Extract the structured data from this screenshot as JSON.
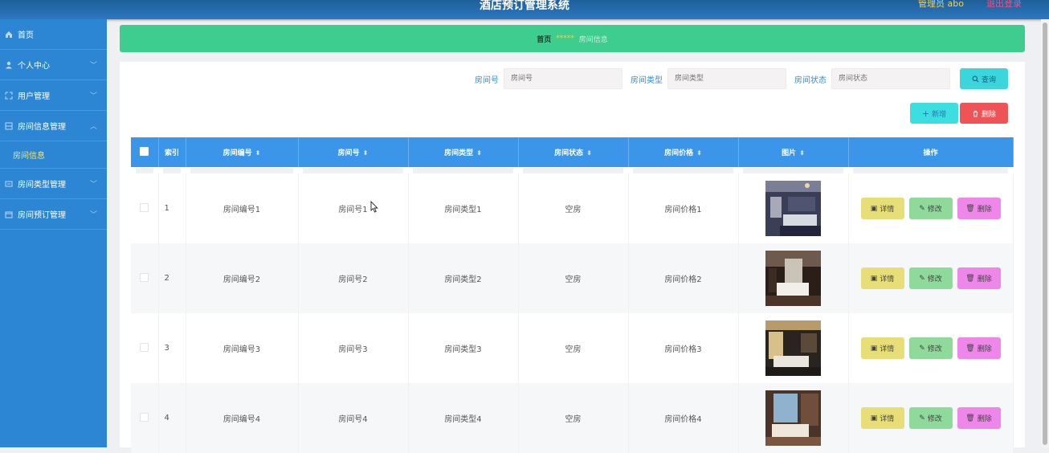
{
  "header": {
    "title": "酒店预订管理系统",
    "user": "管理员 abo",
    "logout": "退出登录"
  },
  "sidebar": {
    "items": [
      {
        "label": "首页",
        "icon": "home-icon"
      },
      {
        "label": "个人中心",
        "icon": "user-icon"
      },
      {
        "label": "用户管理",
        "icon": "users-icon"
      },
      {
        "label": "房间信息管理",
        "icon": "grid-icon"
      },
      {
        "label": "房间类型管理",
        "icon": "list-icon"
      },
      {
        "label": "房间预订管理",
        "icon": "calendar-icon"
      }
    ],
    "active_sub": "房间信息"
  },
  "breadcrumb": {
    "home": "首页",
    "stars": "*****",
    "current": "房间信息"
  },
  "search": {
    "room_no_label": "房间号",
    "room_no_placeholder": "房间号",
    "room_type_label": "房间类型",
    "room_type_placeholder": "房间类型",
    "room_status_label": "房间状态",
    "room_status_placeholder": "房间状态",
    "query_button": "查询"
  },
  "actions": {
    "add_button": "新增",
    "delete_button": "删除"
  },
  "table": {
    "columns": [
      "索引",
      "房间编号",
      "房间号",
      "房间类型",
      "房间状态",
      "房间价格",
      "图片",
      "操作"
    ],
    "rows": [
      {
        "index": "1",
        "code": "房间编号1",
        "no": "房间号1",
        "type": "房间类型1",
        "status": "空房",
        "price": "房间价格1"
      },
      {
        "index": "2",
        "code": "房间编号2",
        "no": "房间号2",
        "type": "房间类型2",
        "status": "空房",
        "price": "房间价格2"
      },
      {
        "index": "3",
        "code": "房间编号3",
        "no": "房间号3",
        "type": "房间类型3",
        "status": "空房",
        "price": "房间价格3"
      },
      {
        "index": "4",
        "code": "房间编号4",
        "no": "房间号4",
        "type": "房间类型4",
        "status": "空房",
        "price": "房间价格4"
      }
    ],
    "row_actions": {
      "detail": "详情",
      "edit": "修改",
      "delete": "删除"
    }
  },
  "colors": {
    "header": "#2c78c0",
    "sidebar": "#2d86d3",
    "breadcrumb": "#3dcd8e",
    "table_header": "#3b95e8",
    "delete": "#ee5356"
  }
}
